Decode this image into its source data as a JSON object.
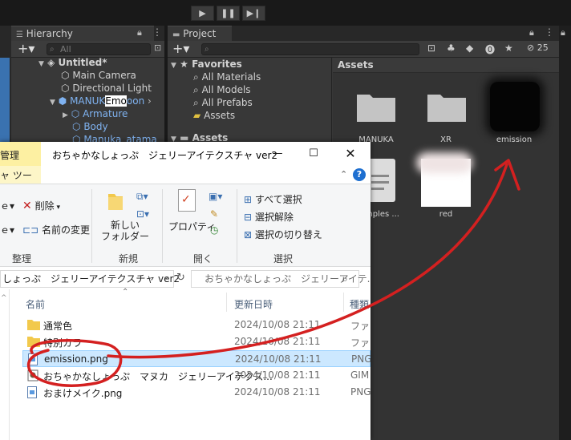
{
  "unity": {
    "hierarchy": {
      "tab": "Hierarchy",
      "search_placeholder": "All",
      "items": [
        {
          "label": "Untitled*",
          "depth": 0
        },
        {
          "label": "Main Camera",
          "depth": 1
        },
        {
          "label": "Directional Light",
          "depth": 1
        },
        {
          "label_pre": "MANUK",
          "label_mid": "Emo",
          "label_post": "oon",
          "depth": 1
        },
        {
          "label": "Armature",
          "depth": 2
        },
        {
          "label": "Body",
          "depth": 2
        },
        {
          "label": "Manuka_atama",
          "depth": 2
        }
      ]
    },
    "project": {
      "tab": "Project",
      "hidden_count": "25",
      "favorites": {
        "title": "Favorites",
        "items": [
          "All Materials",
          "All Models",
          "All Prefabs",
          "Assets"
        ]
      },
      "assets_tree_label": "Assets",
      "assets_header": "Assets",
      "assets": [
        {
          "label": "MANUKA",
          "kind": "folder"
        },
        {
          "label": "XR",
          "kind": "folder"
        },
        {
          "label": "emission",
          "kind": "texture-dark"
        },
        {
          "label": "mples ...",
          "kind": "doc"
        },
        {
          "label": "red",
          "kind": "texture-light"
        }
      ]
    }
  },
  "explorer": {
    "title": "おちゃかなしょっぷ　ジェリーアイテクスチャ ver2",
    "tabs": {
      "manage": "管理",
      "tools": "ャ ツール"
    },
    "ribbon": {
      "delete": "削除",
      "rename": "名前の変更",
      "new_folder_1": "新しい",
      "new_folder_2": "フォルダー",
      "properties": "プロパティ",
      "select_all": "すべて選択",
      "select_none": "選択解除",
      "invert_selection": "選択の切り替え",
      "group_organize": "整理",
      "group_new": "新規",
      "group_open": "開く",
      "group_select": "選択"
    },
    "address": "しょっぷ　ジェリーアイテクスチャ ver2",
    "search_placeholder": "おちゃかなしょっぷ　ジェリーアイテ...",
    "columns": {
      "name": "名前",
      "date": "更新日時",
      "type": "種類"
    },
    "files": [
      {
        "name": "通常色",
        "date": "2024/10/08 21:11",
        "type": "ファイ",
        "kind": "folder"
      },
      {
        "name": "特別カラ",
        "date": "2024/10/08 21:11",
        "type": "ファイ",
        "kind": "folder"
      },
      {
        "name": "emission.png",
        "date": "2024/10/08 21:11",
        "type": "PNG",
        "kind": "png",
        "selected": true
      },
      {
        "name": "おちゃかなしょっぷ　マヌカ　ジェリーアイテクス...",
        "date": "2024/10/08 21:11",
        "type": "GIM",
        "kind": "gimp"
      },
      {
        "name": "おまけメイク.png",
        "date": "2024/10/08 21:11",
        "type": "PNG",
        "kind": "png"
      }
    ]
  },
  "colors": {
    "annotation": "#d42020",
    "unity_bg": "#383838",
    "selection": "#cce8ff"
  }
}
